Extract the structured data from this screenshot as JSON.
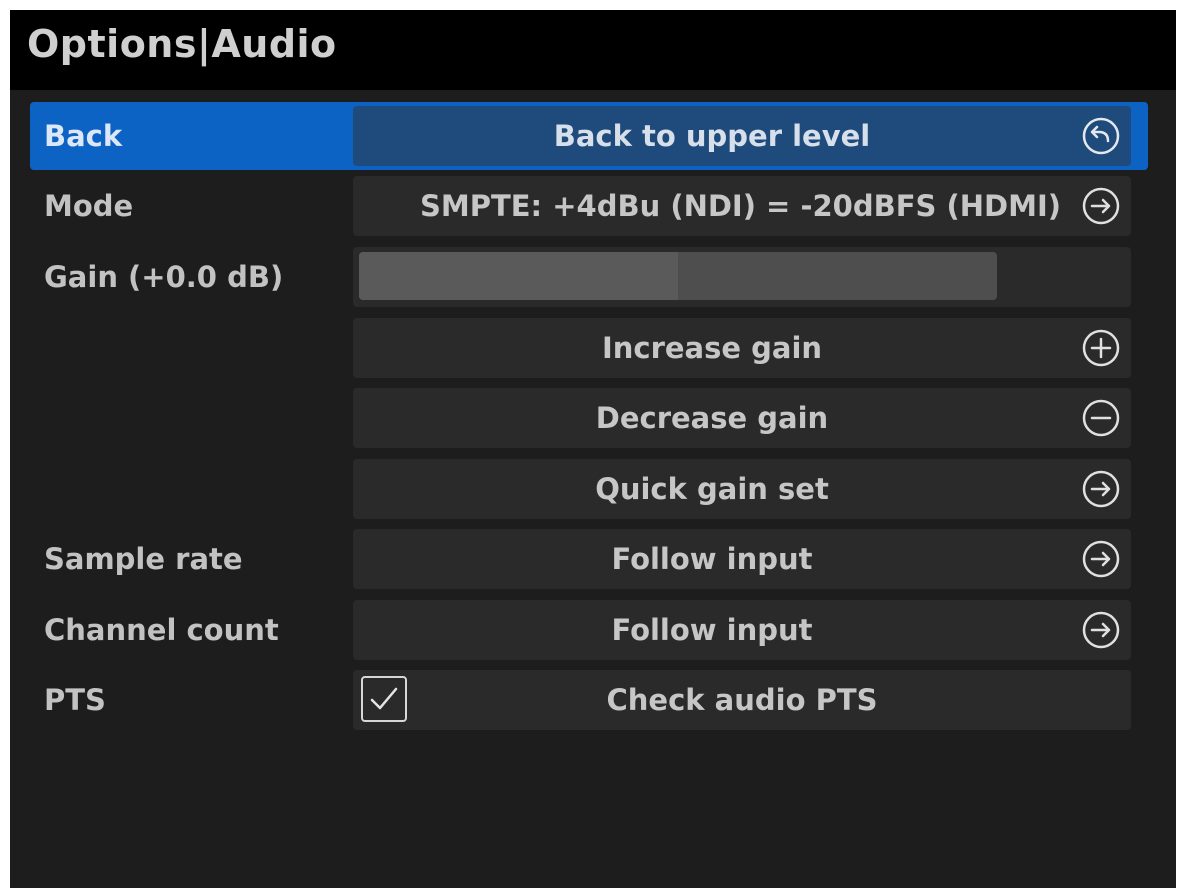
{
  "header": {
    "title": "Options|Audio"
  },
  "menu": {
    "back": {
      "label": "Back",
      "value": "Back to upper level",
      "icon": "return-icon"
    },
    "mode": {
      "label": "Mode",
      "value": "SMPTE: +4dBu (NDI) = -20dBFS (HDMI)",
      "icon": "arrow-right-icon"
    },
    "gain": {
      "label": "Gain (+0.0 dB)",
      "level": 0.5
    },
    "increase_gain": {
      "value": "Increase gain",
      "icon": "plus-icon"
    },
    "decrease_gain": {
      "value": "Decrease gain",
      "icon": "minus-icon"
    },
    "quick_gain": {
      "value": "Quick gain set",
      "icon": "arrow-right-icon"
    },
    "sample_rate": {
      "label": "Sample rate",
      "value": "Follow input",
      "icon": "arrow-right-icon"
    },
    "channel_count": {
      "label": "Channel count",
      "value": "Follow input",
      "icon": "arrow-right-icon"
    },
    "pts": {
      "label": "PTS",
      "value": "Check audio PTS",
      "checked": true
    }
  },
  "colors": {
    "selection": "#0d63c4",
    "background": "#1d1d1d",
    "title_bar": "#000000"
  }
}
